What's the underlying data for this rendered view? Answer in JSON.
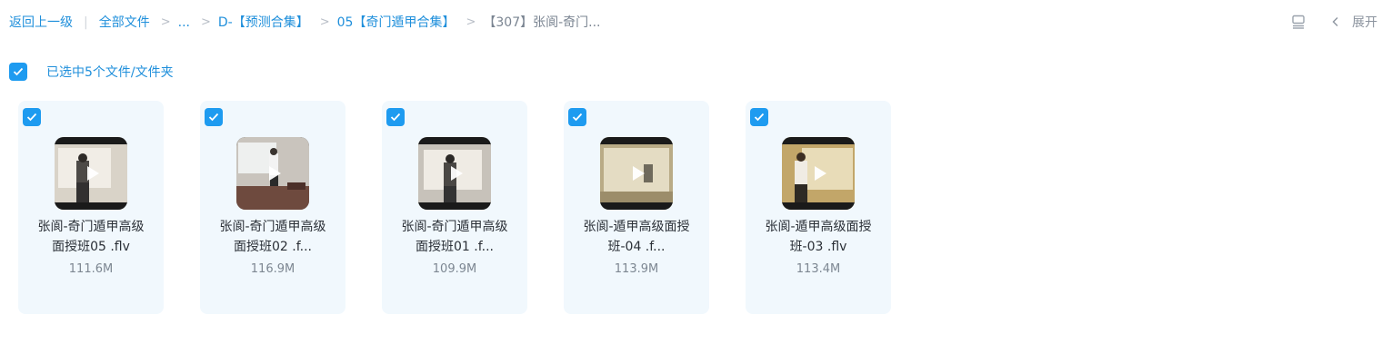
{
  "breadcrumb": {
    "back_label": "返回上一级",
    "items": [
      {
        "label": "全部文件"
      },
      {
        "label": "..."
      },
      {
        "label": "D-【预测合集】"
      },
      {
        "label": "05【奇门遁甲合集】"
      },
      {
        "label": "【307】张阆-奇门..."
      }
    ]
  },
  "toolbar": {
    "expand_label": "展开"
  },
  "selection": {
    "label": "已选中5个文件/文件夹"
  },
  "files": [
    {
      "name_line1": "张阆-奇门遁甲高级",
      "name_line2": "面授班05 .flv",
      "size": "111.6M",
      "icon": "video-thumbnail"
    },
    {
      "name_line1": "张阆-奇门遁甲高级",
      "name_line2": "面授班02 .f...",
      "size": "116.9M",
      "icon": "video-thumbnail"
    },
    {
      "name_line1": "张阆-奇门遁甲高级",
      "name_line2": "面授班01 .f...",
      "size": "109.9M",
      "icon": "video-thumbnail"
    },
    {
      "name_line1": "张阆-遁甲高级面授",
      "name_line2": "班-04 .f...",
      "size": "113.9M",
      "icon": "video-thumbnail"
    },
    {
      "name_line1": "张阆-遁甲高级面授",
      "name_line2": "班-03 .flv",
      "size": "113.4M",
      "icon": "video-thumbnail"
    }
  ],
  "colors": {
    "accent": "#1e9bf0",
    "card_bg": "#f1f8fd"
  }
}
